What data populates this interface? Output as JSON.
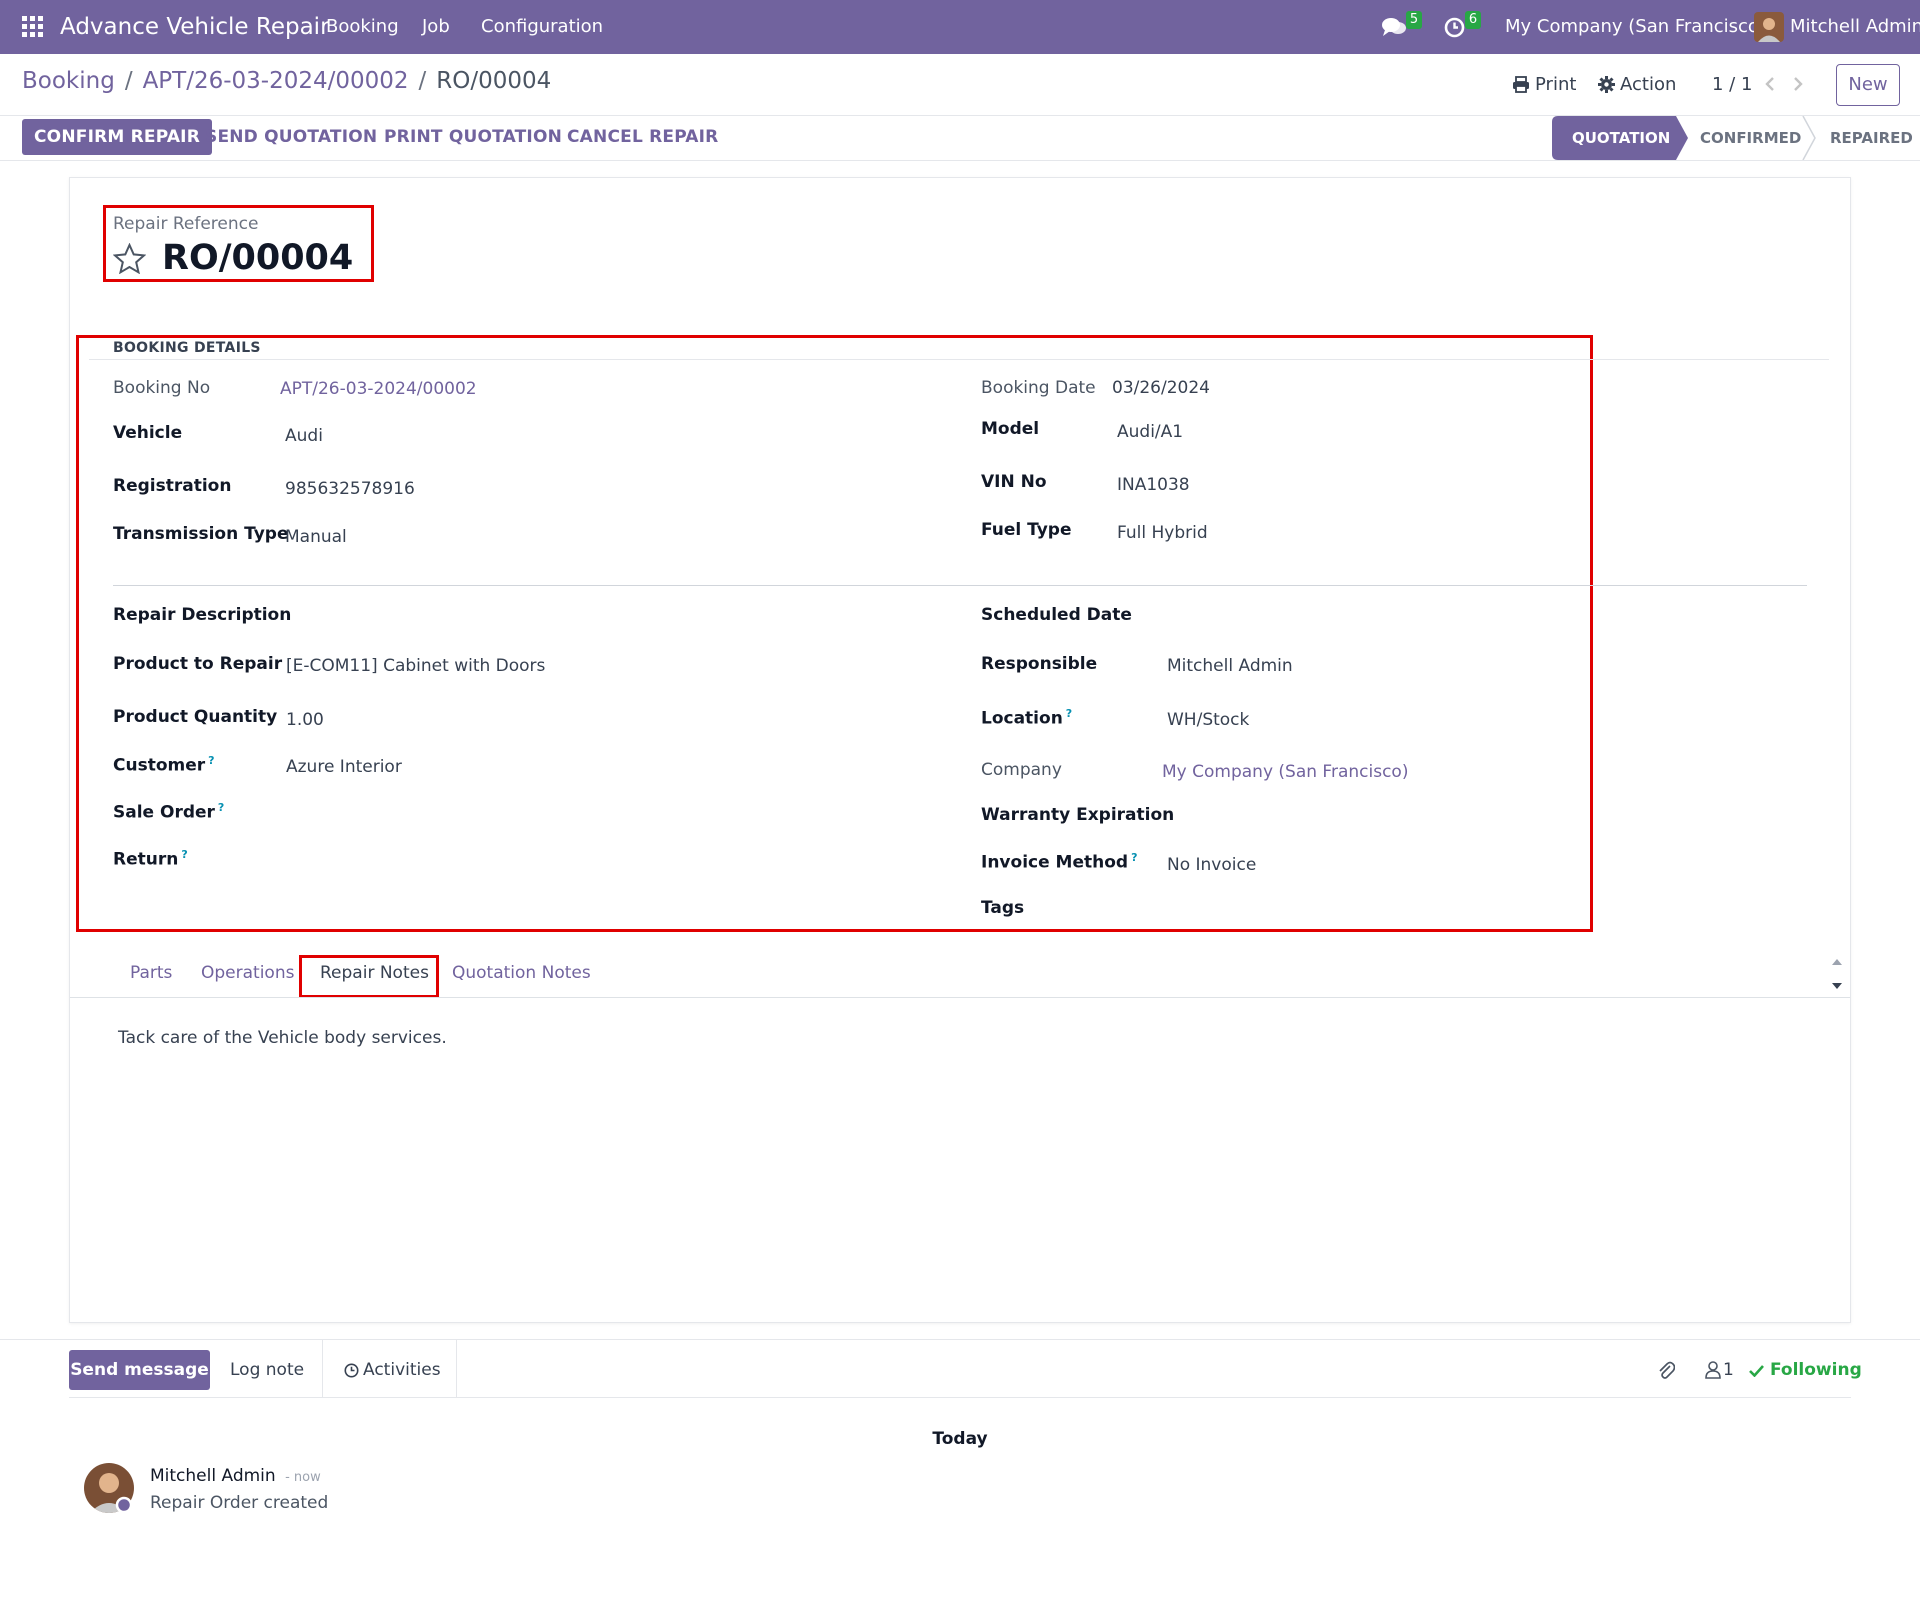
{
  "navbar": {
    "app_name": "Advance Vehicle Repair",
    "menu": [
      "Booking",
      "Job",
      "Configuration"
    ],
    "messages_count": "5",
    "activities_count": "6",
    "company": "My Company (San Francisco)",
    "user": "Mitchell Admin",
    "bg_color": "#71639e"
  },
  "breadcrumb": {
    "items": [
      "Booking",
      "APT/26-03-2024/00002",
      "RO/00004"
    ],
    "separator": "/"
  },
  "control": {
    "print_label": "Print",
    "action_label": "Action",
    "pager": "1 / 1",
    "new_label": "New"
  },
  "statusbar": {
    "buttons": [
      "CONFIRM REPAIR",
      "SEND QUOTATION",
      "PRINT QUOTATION",
      "CANCEL REPAIR"
    ],
    "stages": [
      "QUOTATION",
      "CONFIRMED",
      "REPAIRED"
    ],
    "active_stage": "QUOTATION"
  },
  "title": {
    "label": "Repair Reference",
    "value": "RO/00004"
  },
  "booking": {
    "section_title": "BOOKING DETAILS",
    "booking_no": {
      "label": "Booking No",
      "value": "APT/26-03-2024/00002"
    },
    "booking_date": {
      "label": "Booking Date",
      "value": "03/26/2024"
    },
    "vehicle": {
      "label": "Vehicle",
      "value": "Audi"
    },
    "model": {
      "label": "Model",
      "value": "Audi/A1"
    },
    "registration": {
      "label": "Registration",
      "value": "985632578916"
    },
    "vin": {
      "label": "VIN No",
      "value": "INA1038"
    },
    "transmission": {
      "label": "Transmission Type",
      "value": "Manual"
    },
    "fuel": {
      "label": "Fuel Type",
      "value": "Full Hybrid"
    }
  },
  "repair": {
    "description": {
      "label": "Repair Description",
      "value": ""
    },
    "scheduled": {
      "label": "Scheduled Date",
      "value": ""
    },
    "product": {
      "label": "Product to Repair",
      "value": "[E-COM11] Cabinet with Doors"
    },
    "responsible": {
      "label": "Responsible",
      "value": "Mitchell Admin"
    },
    "quantity": {
      "label": "Product Quantity",
      "value": "1.00"
    },
    "location": {
      "label": "Location",
      "value": "WH/Stock"
    },
    "customer": {
      "label": "Customer",
      "value": "Azure Interior"
    },
    "company": {
      "label": "Company",
      "value": "My Company (San Francisco)"
    },
    "sale_order": {
      "label": "Sale Order",
      "value": ""
    },
    "warranty": {
      "label": "Warranty Expiration",
      "value": ""
    },
    "return": {
      "label": "Return",
      "value": ""
    },
    "invoice_method": {
      "label": "Invoice Method",
      "value": "No Invoice"
    },
    "tags": {
      "label": "Tags",
      "value": ""
    },
    "help_mark": "?"
  },
  "tabs": {
    "items": [
      "Parts",
      "Operations",
      "Repair Notes",
      "Quotation Notes"
    ],
    "active": "Repair Notes",
    "content": "Tack care of the Vehicle body services."
  },
  "chatter": {
    "send_message": "Send message",
    "log_note": "Log note",
    "activities": "Activities",
    "followers_count": "1",
    "following": "Following",
    "date_separator": "Today",
    "message": {
      "author": "Mitchell Admin",
      "time": "- now",
      "body": "Repair Order created"
    }
  },
  "colors": {
    "primary": "#71639e",
    "highlight": "#e00000",
    "success": "#28a745"
  }
}
